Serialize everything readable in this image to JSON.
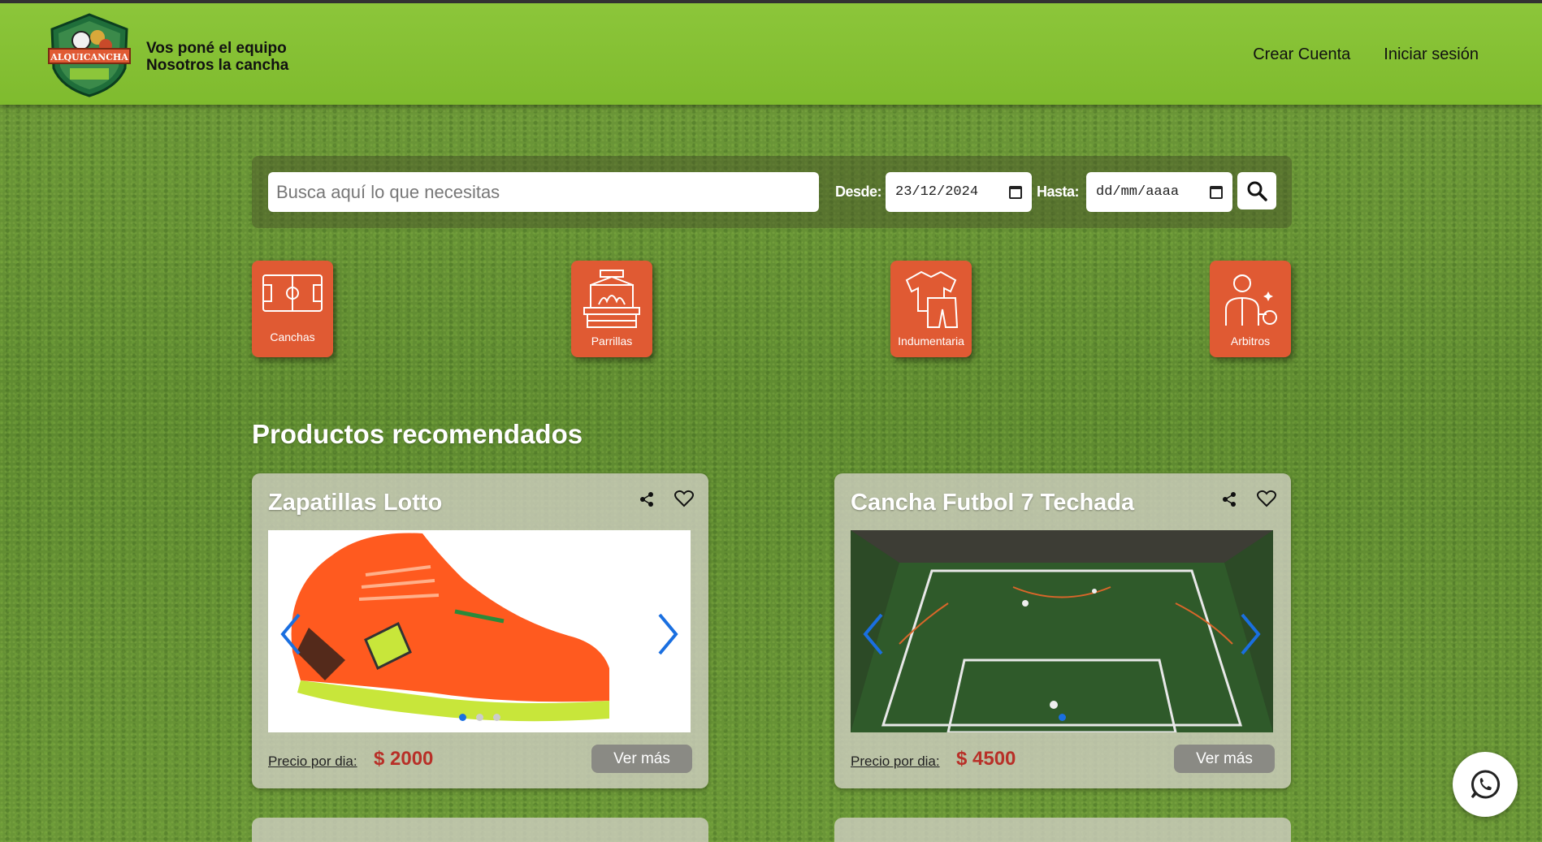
{
  "header": {
    "tagline_line1": "Vos poné el equipo",
    "tagline_line2": "Nosotros la cancha",
    "logo_text": "ALQUICANCHA",
    "nav": {
      "create_account": "Crear Cuenta",
      "sign_in": "Iniciar sesión"
    }
  },
  "search": {
    "placeholder": "Busca aquí lo que necesitas",
    "from_label": "Desde:",
    "from_value": "23/12/2024",
    "to_label": "Hasta:",
    "to_value": "dd/mm/aaaa"
  },
  "categories": [
    {
      "label": "Canchas",
      "icon": "soccer-field-icon"
    },
    {
      "label": "Parrillas",
      "icon": "grill-icon"
    },
    {
      "label": "Indumentaria",
      "icon": "clothing-icon"
    },
    {
      "label": "Arbitros",
      "icon": "referee-icon"
    }
  ],
  "recommended": {
    "title": "Productos recomendados",
    "products": [
      {
        "name": "Zapatillas Lotto",
        "price_label": "Precio por dia:",
        "price": "$ 2000",
        "button": "Ver más",
        "image": "orange-soccer-shoe",
        "active_slide": 1,
        "slides": 3
      },
      {
        "name": "Cancha Futbol 7 Techada",
        "price_label": "Precio por dia:",
        "price": "$ 4500",
        "button": "Ver más",
        "image": "indoor-soccer-field",
        "active_slide": 1,
        "slides": 1
      }
    ]
  },
  "colors": {
    "header": "#8cc63a",
    "category": "#e05a33",
    "price": "#b83028",
    "dot_active": "#1a6fe0"
  }
}
